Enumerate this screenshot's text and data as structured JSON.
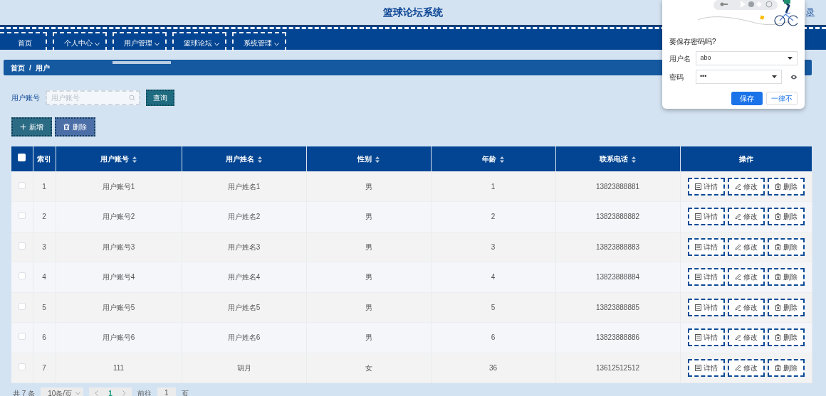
{
  "header": {
    "title": "篮球论坛系统",
    "user_link": "录"
  },
  "nav": [
    {
      "label": "首页",
      "dropdown": false,
      "selected": false
    },
    {
      "label": "个人中心",
      "dropdown": true,
      "selected": false
    },
    {
      "label": "用户管理",
      "dropdown": true,
      "selected": true
    },
    {
      "label": "篮球论坛",
      "dropdown": true,
      "selected": false
    },
    {
      "label": "系统管理",
      "dropdown": true,
      "selected": false
    }
  ],
  "breadcrumb": {
    "items": [
      "首页",
      "用户"
    ],
    "separator": "/"
  },
  "search": {
    "label": "用户账号",
    "placeholder": "用户账号",
    "button": "查询"
  },
  "actions": [
    {
      "label": "新增",
      "kind": "add"
    },
    {
      "label": "删除",
      "kind": "delete"
    }
  ],
  "table": {
    "select_all": {
      "checked": false
    },
    "columns": [
      {
        "label": "索引",
        "sortable": false
      },
      {
        "label": "用户账号",
        "sortable": true
      },
      {
        "label": "用户姓名",
        "sortable": true
      },
      {
        "label": "性别",
        "sortable": true
      },
      {
        "label": "年龄",
        "sortable": true
      },
      {
        "label": "联系电话",
        "sortable": true
      },
      {
        "label": "操作",
        "sortable": false
      }
    ],
    "rows": [
      {
        "checked": false,
        "cells": [
          "1",
          "用户账号1",
          "用户姓名1",
          "男",
          "1",
          "13823888881"
        ],
        "buttons": [
          {
            "label": "详情",
            "kind": "detail"
          },
          {
            "label": "修改",
            "kind": "edit"
          },
          {
            "label": "删除",
            "kind": "delete"
          }
        ]
      },
      {
        "checked": false,
        "cells": [
          "2",
          "用户账号2",
          "用户姓名2",
          "男",
          "2",
          "13823888882"
        ],
        "buttons": [
          {
            "label": "详情",
            "kind": "detail"
          },
          {
            "label": "修改",
            "kind": "edit"
          },
          {
            "label": "删除",
            "kind": "delete"
          }
        ]
      },
      {
        "checked": false,
        "cells": [
          "3",
          "用户账号3",
          "用户姓名3",
          "男",
          "3",
          "13823888883"
        ],
        "buttons": [
          {
            "label": "详情",
            "kind": "detail"
          },
          {
            "label": "修改",
            "kind": "edit"
          },
          {
            "label": "删除",
            "kind": "delete"
          }
        ]
      },
      {
        "checked": false,
        "cells": [
          "4",
          "用户账号4",
          "用户姓名4",
          "男",
          "4",
          "13823888884"
        ],
        "buttons": [
          {
            "label": "详情",
            "kind": "detail"
          },
          {
            "label": "修改",
            "kind": "edit"
          },
          {
            "label": "删除",
            "kind": "delete"
          }
        ]
      },
      {
        "checked": false,
        "cells": [
          "5",
          "用户账号5",
          "用户姓名5",
          "男",
          "5",
          "13823888885"
        ],
        "buttons": [
          {
            "label": "详情",
            "kind": "detail"
          },
          {
            "label": "修改",
            "kind": "edit"
          },
          {
            "label": "删除",
            "kind": "delete"
          }
        ]
      },
      {
        "checked": false,
        "cells": [
          "6",
          "用户账号6",
          "用户姓名6",
          "男",
          "6",
          "13823888886"
        ],
        "buttons": [
          {
            "label": "详情",
            "kind": "detail"
          },
          {
            "label": "修改",
            "kind": "edit"
          },
          {
            "label": "删除",
            "kind": "delete"
          }
        ]
      },
      {
        "checked": false,
        "cells": [
          "7",
          "111",
          "胡月",
          "女",
          "36",
          "13612512512"
        ],
        "buttons": [
          {
            "label": "详情",
            "kind": "detail"
          },
          {
            "label": "修改",
            "kind": "edit"
          },
          {
            "label": "删除",
            "kind": "delete"
          }
        ]
      }
    ]
  },
  "pagination": {
    "total": "共 7 条",
    "page_size": "10条/页",
    "pages": [
      {
        "label": "1",
        "selected": true
      }
    ],
    "goto_label": "前往",
    "goto_value": "1",
    "goto_suffix": "页"
  },
  "password_popup": {
    "question": "要保存密码吗?",
    "username_label": "用户名",
    "username_value": "abo",
    "password_label": "密码",
    "password_value": "•••",
    "save_button": "保存",
    "never_button": "一律不"
  }
}
